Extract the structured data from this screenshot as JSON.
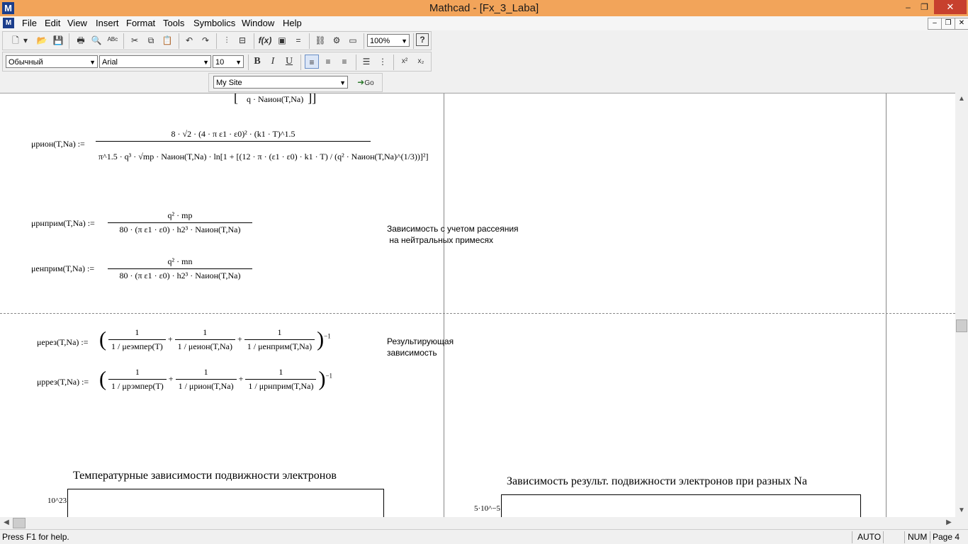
{
  "window": {
    "title": "Mathcad - [Fx_3_Laba]",
    "app_icon": "M",
    "minimize": "–",
    "maximize": "❐",
    "close": "✕"
  },
  "menu": [
    "File",
    "Edit",
    "View",
    "Insert",
    "Format",
    "Tools",
    "Symbolics",
    "Window",
    "Help"
  ],
  "toolbar": {
    "zoom": "100%",
    "style": "Обычный",
    "font": "Arial",
    "font_size": "10",
    "bold": "B",
    "italic": "I",
    "underline": "U",
    "superscript": "x²",
    "subscript": "x₂",
    "site": "My Site",
    "go": "Go"
  },
  "worksheet": {
    "top_fragment": "q · Naион(T,Na)",
    "mu_rion_lhs": "μрион(T,Na) :=",
    "mu_rion_num": "8 · √2 · (4 · π ε1 · ε0)² · (k1 · T)^1.5",
    "mu_rion_den": "π^1.5 · q³ · √mp · Naион(T,Na) · ln[1 + [(12 · π · (ε1 · ε0) · k1 · T) / (q² · Naион(T,Na)^(1/3))]²]",
    "mu_rnprim_lhs": "μрнприм(T,Na) :=",
    "mu_rnprim_num": "q² · mp",
    "mu_rnprim_den": "80 · (π ε1 · ε0) · h2³ · Naион(T,Na)",
    "mu_enprim_lhs": "μенприм(T,Na) :=",
    "mu_enprim_num": "q² · mn",
    "mu_enprim_den": "80 · (π ε1 · ε0) · h2³ · Naион(T,Na)",
    "note_neutral": "Зависимость с учетом рассеяния\n на нейтральных примесях",
    "mu_eres_lhs": "μерез(T,Na) :=",
    "mu_eres_terms": [
      "1 / μеэмпер(T)",
      "1 / μеион(T,Na)",
      "1 / μенприм(T,Na)"
    ],
    "mu_rres_lhs": "μррез(T,Na) :=",
    "mu_rres_terms": [
      "1 / μрэмпер(T)",
      "1 / μрион(T,Na)",
      "1 / μрнприм(T,Na)"
    ],
    "exponent": "−1",
    "note_result": "Результирующая\nзависимость",
    "plot1_title": "Температурные зависимости подвижности электронов",
    "plot1_ytick": "10^23",
    "plot2_title": "Зависимость результ. подвижности электронов при разных Na",
    "plot2_ytick": "5·10^−5"
  },
  "status": {
    "help": "Press F1 for help.",
    "mode": "AUTO",
    "num": "NUM",
    "page": "Page 4"
  }
}
